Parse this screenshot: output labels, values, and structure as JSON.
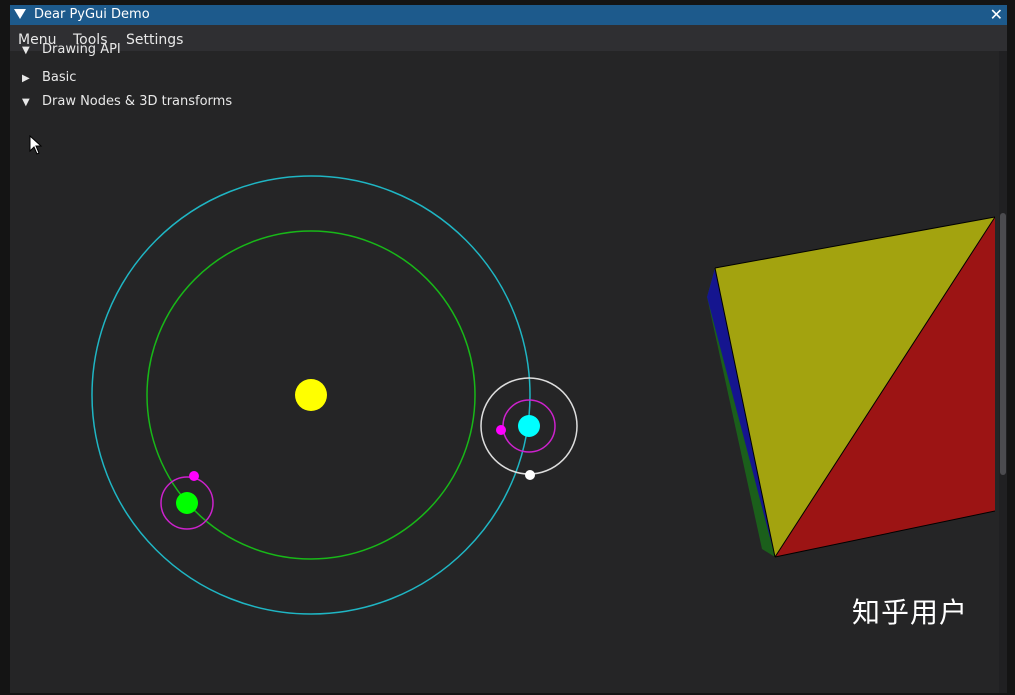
{
  "window": {
    "title": "Dear PyGui Demo",
    "close_icon": "close-icon"
  },
  "menubar": {
    "items": [
      "Menu",
      "Tools",
      "Settings"
    ]
  },
  "tree": {
    "cut_header": "Drawing API",
    "items": [
      {
        "label": "Basic",
        "expanded": false
      },
      {
        "label": "Draw Nodes & 3D transforms",
        "expanded": true
      }
    ]
  },
  "watermark": "知乎用户",
  "colors": {
    "titlebar": "#1d5a8c",
    "sun": "#ffff00",
    "earth": "#00ff00",
    "orbit_cyan": "#1fb6c4",
    "orbit_green": "#18b818",
    "moon": "#ff00ff",
    "planet2": "#00ffff",
    "face_yellow": "#a3a30f",
    "face_red": "#9c1414",
    "face_blue": "#15158f",
    "face_green": "#1b5f1b"
  }
}
